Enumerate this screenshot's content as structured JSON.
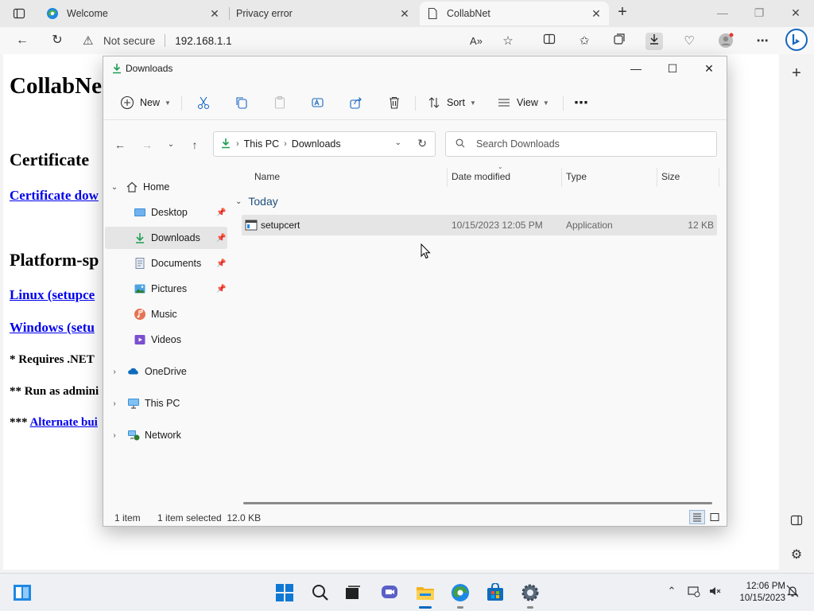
{
  "browser": {
    "tabs": [
      {
        "label": "Welcome",
        "active": false
      },
      {
        "label": "Privacy error",
        "active": false
      },
      {
        "label": "CollabNet",
        "active": true
      }
    ],
    "address": {
      "security_label": "Not secure",
      "url": "192.168.1.1"
    }
  },
  "page": {
    "title": "CollabNe",
    "section1": "Certificate",
    "link_cert": "Certificate dow",
    "section2": "Platform-sp",
    "link_linux": "Linux (setupce",
    "link_windows": "Windows (setu",
    "note1": "* Requires .NET",
    "note2": "** Run as admini",
    "note3_prefix": "***",
    "note3_link": "Alternate bui"
  },
  "explorer": {
    "title": "Downloads",
    "commands": {
      "new": "New",
      "sort": "Sort",
      "view": "View",
      "more": "⋯"
    },
    "breadcrumb": [
      "This PC",
      "Downloads"
    ],
    "search_placeholder": "Search Downloads",
    "nav": {
      "home": "Home",
      "desktop": "Desktop",
      "downloads": "Downloads",
      "documents": "Documents",
      "pictures": "Pictures",
      "music": "Music",
      "videos": "Videos",
      "onedrive": "OneDrive",
      "thispc": "This PC",
      "network": "Network"
    },
    "columns": {
      "name": "Name",
      "date": "Date modified",
      "type": "Type",
      "size": "Size"
    },
    "group": "Today",
    "files": [
      {
        "name": "setupcert",
        "date": "10/15/2023 12:05 PM",
        "type": "Application",
        "size": "12 KB"
      }
    ],
    "status": {
      "count": "1 item",
      "selection": "1 item selected  12.0 KB"
    }
  },
  "taskbar": {
    "time": "12:06 PM",
    "date": "10/15/2023"
  }
}
